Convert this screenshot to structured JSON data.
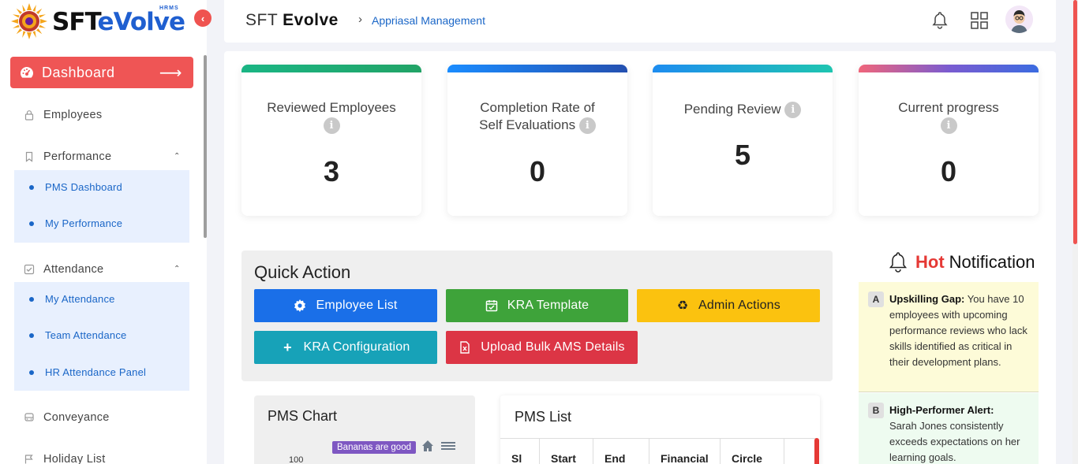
{
  "brand": {
    "sft": "SFT",
    "evolve": "eVolve",
    "tag": "HRMS"
  },
  "sidebar": {
    "dashboard_label": "Dashboard",
    "items": [
      {
        "label": "Employees",
        "icon": "lock-icon"
      },
      {
        "label": "Performance",
        "icon": "bookmark-icon"
      },
      {
        "label": "Attendance",
        "icon": "check-square-icon"
      },
      {
        "label": "Conveyance",
        "icon": "car-icon"
      },
      {
        "label": "Holiday List",
        "icon": "flag-icon"
      }
    ],
    "performance_sub": [
      "PMS Dashboard",
      "My Performance"
    ],
    "attendance_sub": [
      "My Attendance",
      "Team Attendance",
      "HR Attendance Panel"
    ]
  },
  "header": {
    "title_light": "SFT",
    "title_bold": "Evolve",
    "breadcrumb": "Appriasal Management"
  },
  "stats": [
    {
      "label": "Reviewed Employees",
      "value": "3"
    },
    {
      "label": "Completion Rate of Self Evaluations",
      "label_line1": "Completion Rate of",
      "label_line2": "Self Evaluations",
      "value": "0"
    },
    {
      "label": "Pending Review",
      "value": "5"
    },
    {
      "label": "Current progress",
      "value": "0"
    }
  ],
  "quick_action": {
    "title": "Quick Action",
    "buttons": [
      {
        "label": "Employee List",
        "icon": "gear-icon",
        "color": "#1a6fe8"
      },
      {
        "label": "KRA Template",
        "icon": "calendar-check-icon",
        "color": "#3ea33a"
      },
      {
        "label": "Admin Actions",
        "icon": "recycle-icon",
        "color": "#fbc20f"
      },
      {
        "label": "KRA Configuration",
        "icon": "plus-icon",
        "color": "#17a2b8"
      },
      {
        "label": "Upload Bulk AMS Details",
        "icon": "file-excel-icon",
        "color": "#dc3545"
      }
    ]
  },
  "pms_chart": {
    "title": "PMS Chart",
    "tooltip": "Bananas are good",
    "y_tick": "100"
  },
  "pms_list": {
    "title": "PMS List",
    "columns": [
      "Sl",
      "Start",
      "End",
      "Financial",
      "Circle"
    ]
  },
  "notifications": {
    "title_hot": "Hot",
    "title_rest": "Notification",
    "items": [
      {
        "badge": "A",
        "heading": "Upskilling Gap:",
        "body": "You have 10 employees with upcoming performance reviews who lack skills identified as critical in their development plans.",
        "bg": "#fdfbd8"
      },
      {
        "badge": "B",
        "heading": "High-Performer Alert:",
        "body": "Sarah Jones consistently exceeds expectations on her learning goals.",
        "bg": "#eefbf0"
      }
    ]
  },
  "colors": {
    "accent": "#ef5555",
    "link": "#1a66c7"
  }
}
